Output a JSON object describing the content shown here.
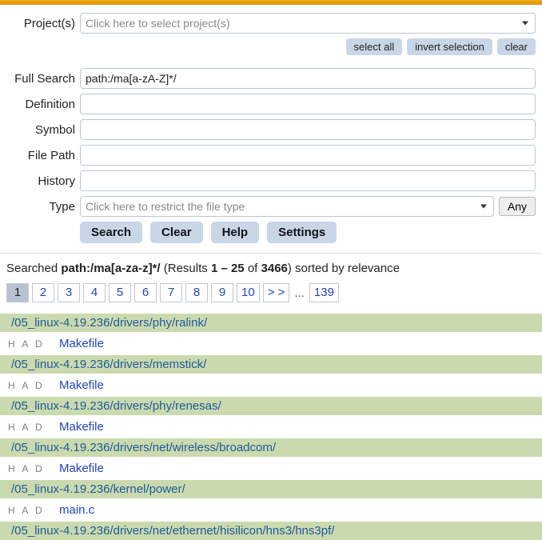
{
  "form": {
    "projects": {
      "label": "Project(s)",
      "placeholder": "Click here to select project(s)"
    },
    "buttons_right": {
      "select_all": "select all",
      "invert": "invert selection",
      "clear": "clear"
    },
    "full_search": {
      "label": "Full Search",
      "value": "path:/ma[a-zA-Z]*/"
    },
    "definition": {
      "label": "Definition",
      "value": ""
    },
    "symbol": {
      "label": "Symbol",
      "value": ""
    },
    "file_path": {
      "label": "File Path",
      "value": ""
    },
    "history": {
      "label": "History",
      "value": ""
    },
    "type": {
      "label": "Type",
      "placeholder": "Click here to restrict the file type",
      "any_label": "Any"
    },
    "actions": {
      "search": "Search",
      "clear": "Clear",
      "help": "Help",
      "settings": "Settings"
    }
  },
  "summary": {
    "prefix": "Searched ",
    "query_bold": "path:/ma[a-za-z]*/",
    "mid1": " (Results ",
    "range": "1 – 25",
    "mid2": " of ",
    "total": "3466",
    "suffix": ") sorted by relevance"
  },
  "pager": {
    "pages": [
      "1",
      "2",
      "3",
      "4",
      "5",
      "6",
      "7",
      "8",
      "9",
      "10"
    ],
    "next": "> >",
    "ellipsis": "...",
    "last": "139",
    "current": "1"
  },
  "results": [
    {
      "path": "/05_linux-4.19.236/drivers/phy/ralink/",
      "had": "H A D",
      "file": "Makefile"
    },
    {
      "path": "/05_linux-4.19.236/drivers/memstick/",
      "had": "H A D",
      "file": "Makefile"
    },
    {
      "path": "/05_linux-4.19.236/drivers/phy/renesas/",
      "had": "H A D",
      "file": "Makefile"
    },
    {
      "path": "/05_linux-4.19.236/drivers/net/wireless/broadcom/",
      "had": "H A D",
      "file": "Makefile"
    },
    {
      "path": "/05_linux-4.19.236/kernel/power/",
      "had": "H A D",
      "file": "main.c"
    },
    {
      "path": "/05_linux-4.19.236/drivers/net/ethernet/hisilicon/hns3/hns3pf/",
      "had": "",
      "file": ""
    }
  ]
}
